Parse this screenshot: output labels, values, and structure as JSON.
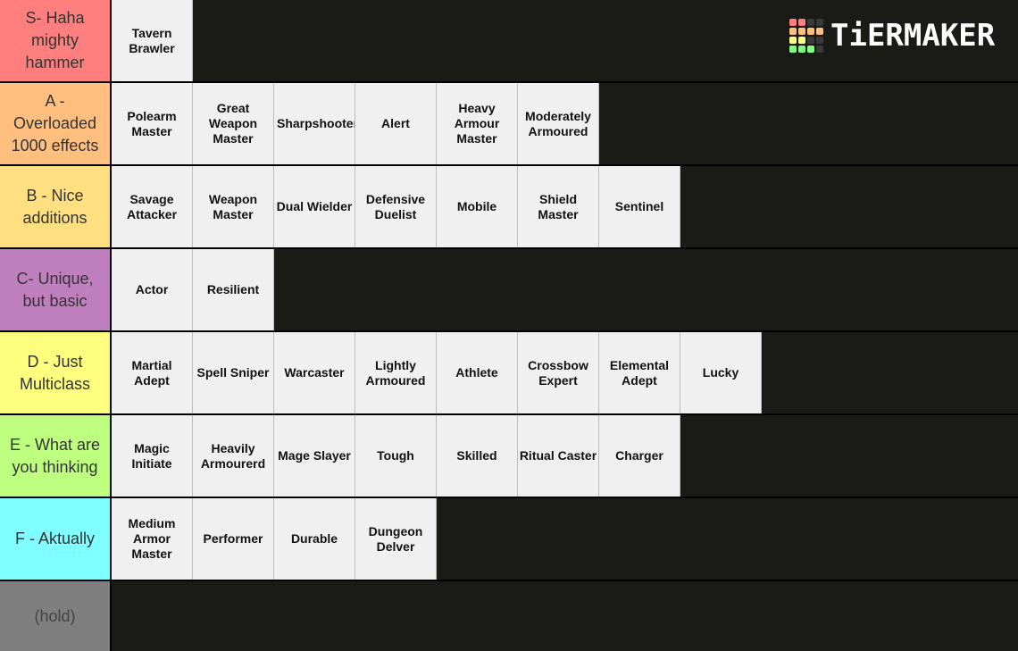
{
  "logo": {
    "text": "TiERMAKER",
    "grid_colors": [
      "#ff7f7f",
      "#ff7f7f",
      "#3a3a3a",
      "#3a3a3a",
      "#ffbf7f",
      "#ffbf7f",
      "#ffbf7f",
      "#ffbf7f",
      "#ffff7f",
      "#ffff7f",
      "#3a3a3a",
      "#3a3a3a",
      "#7fff7f",
      "#7fff7f",
      "#7fff7f",
      "#3a3a3a"
    ]
  },
  "tiers": [
    {
      "label": "S- Haha mighty hammer",
      "color": "#ff7f7f",
      "items": [
        "Tavern Brawler"
      ]
    },
    {
      "label": "A - Overloaded 1000 effects",
      "color": "#ffbf7f",
      "items": [
        "Polearm Master",
        "Great Weapon Master",
        "Sharpshooter",
        "Alert",
        "Heavy Armour Master",
        "Moderately Armoured"
      ]
    },
    {
      "label": "B - Nice additions",
      "color": "#ffdf7f",
      "items": [
        "Savage Attacker",
        "Weapon Master",
        "Dual Wielder",
        "Defensive Duelist",
        "Mobile",
        "Shield Master",
        "Sentinel"
      ]
    },
    {
      "label": "C- Unique, but basic",
      "color": "#bf7fbf",
      "items": [
        "Actor",
        "Resilient"
      ]
    },
    {
      "label": "D - Just Multiclass",
      "color": "#ffff7f",
      "items": [
        "Martial Adept",
        "Spell Sniper",
        "Warcaster",
        "Lightly Armoured",
        "Athlete",
        "Crossbow Expert",
        "Elemental Adept",
        "Lucky"
      ]
    },
    {
      "label": "E - What are you thinking",
      "color": "#bfff7f",
      "items": [
        "Magic Initiate",
        "Heavily Armourerd",
        "Mage Slayer",
        "Tough",
        "Skilled",
        "Ritual Caster",
        "Charger"
      ]
    },
    {
      "label": "F - Aktually",
      "color": "#7fffff",
      "items": [
        "Medium Armor Master",
        "Performer",
        "Durable",
        "Dungeon Delver"
      ]
    },
    {
      "label": "(hold)",
      "color": "#7f7f7f",
      "items": []
    }
  ]
}
